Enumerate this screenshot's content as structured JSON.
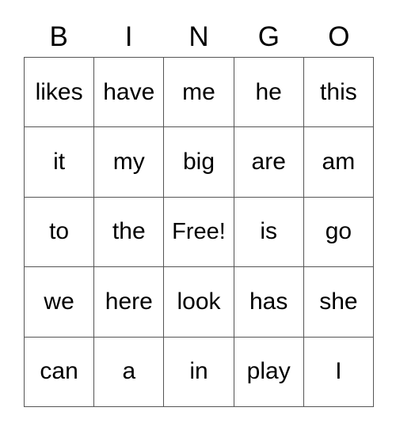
{
  "card": {
    "title": "BINGO",
    "header_letters": [
      "B",
      "I",
      "N",
      "G",
      "O"
    ],
    "free_space_label": "Free!",
    "free_space_position": {
      "row": 2,
      "col": 2
    },
    "grid_size": "5x5",
    "colors": {
      "background": "#ffffff",
      "text": "#000000",
      "border": "#555555"
    },
    "rows": [
      {
        "cells": [
          "likes",
          "have",
          "me",
          "he",
          "this"
        ]
      },
      {
        "cells": [
          "it",
          "my",
          "big",
          "are",
          "am"
        ]
      },
      {
        "cells": [
          "to",
          "the",
          "Free!",
          "is",
          "go"
        ]
      },
      {
        "cells": [
          "we",
          "here",
          "look",
          "has",
          "she"
        ]
      },
      {
        "cells": [
          "can",
          "a",
          "in",
          "play",
          "I"
        ]
      }
    ]
  }
}
